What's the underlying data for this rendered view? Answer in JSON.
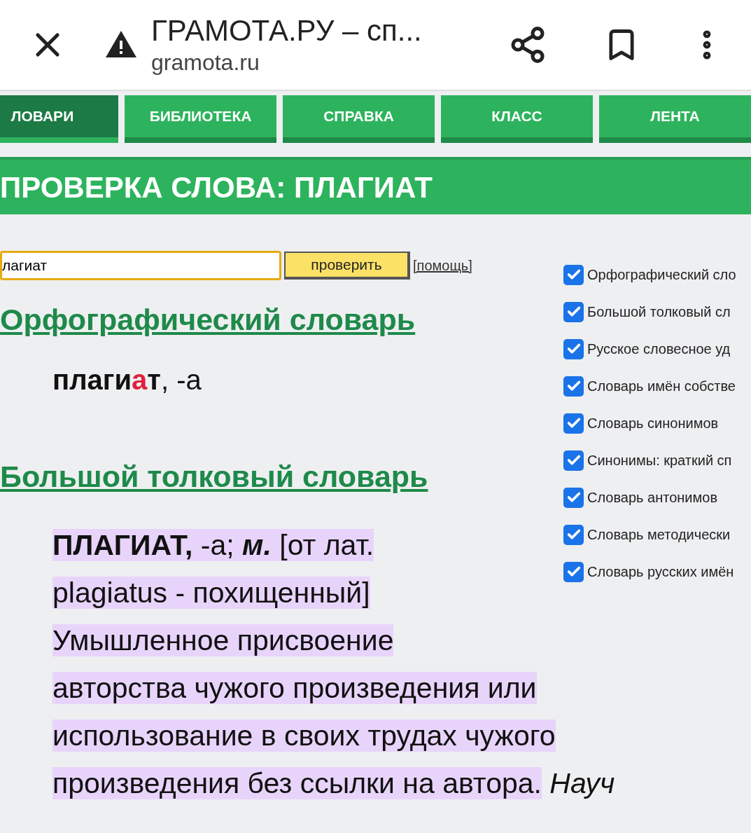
{
  "browser": {
    "title": "ГРАМОТА.РУ – сп...",
    "url": "gramota.ru"
  },
  "nav": [
    {
      "label": "ЛОВАРИ",
      "selected": true
    },
    {
      "label": "БИБЛИОТЕКА",
      "selected": false
    },
    {
      "label": "СПРАВКА",
      "selected": false
    },
    {
      "label": "КЛАСС",
      "selected": false
    },
    {
      "label": "ЛЕНТА",
      "selected": false
    }
  ],
  "banner": "ПРОВЕРКА СЛОВА: ПЛАГИАТ",
  "search": {
    "value": "лагиат",
    "button": "проверить",
    "help": "[помощь]"
  },
  "dictionaries": [
    {
      "label": "Орфографический сло",
      "checked": true
    },
    {
      "label": "Большой толковый сл",
      "checked": true
    },
    {
      "label": "Русское словесное уд",
      "checked": true
    },
    {
      "label": "Словарь имён собстве",
      "checked": true
    },
    {
      "label": "Словарь синонимов",
      "checked": true
    },
    {
      "label": "Синонимы: краткий сп",
      "checked": true
    },
    {
      "label": "Словарь антонимов",
      "checked": true
    },
    {
      "label": "Словарь методически",
      "checked": true
    },
    {
      "label": "Словарь русских имён",
      "checked": true
    }
  ],
  "sections": [
    {
      "title": "Орфографический словарь",
      "kind": "word",
      "parts": [
        {
          "text": "плаги",
          "kind": "bold"
        },
        {
          "text": "а",
          "kind": "stress"
        },
        {
          "text": "т",
          "kind": "bold"
        },
        {
          "text": ", -а",
          "kind": "plain"
        }
      ]
    },
    {
      "title": "Большой толковый словарь",
      "kind": "definition",
      "lines": [
        {
          "highlighted": [
            {
              "text": "ПЛАГИАТ,",
              "kind": "bold"
            },
            {
              "text": " -а; ",
              "kind": "plain"
            },
            {
              "text": "м.",
              "kind": "bolditalic"
            },
            {
              "text": " [от лат.",
              "kind": "plain"
            }
          ]
        },
        {
          "highlighted": [
            {
              "text": "plagiatus - похищенный]",
              "kind": "plain"
            }
          ]
        },
        {
          "highlighted": [
            {
              "text": "Умышленное присвоение",
              "kind": "plain"
            }
          ]
        },
        {
          "highlighted": [
            {
              "text": "авторства чужого произведения или",
              "kind": "plain"
            }
          ]
        },
        {
          "highlighted": [
            {
              "text": "использование в своих трудах чужого",
              "kind": "plain"
            }
          ]
        },
        {
          "highlighted": [
            {
              "text": "произведения без ссылки на автора.",
              "kind": "plain"
            }
          ],
          "rest": [
            {
              "text": " Науч",
              "kind": "italic"
            }
          ]
        }
      ]
    }
  ]
}
